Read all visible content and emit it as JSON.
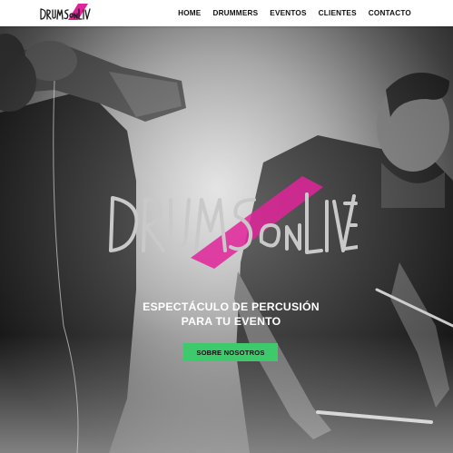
{
  "brand": {
    "name": "DRUMS ON LIVE",
    "logo_text_a": "DRUMS",
    "logo_text_b": "ON",
    "logo_text_c": "LIVE",
    "accent_color": "#e0249a"
  },
  "nav": {
    "items": [
      {
        "label": "HOME"
      },
      {
        "label": "DRUMMERS"
      },
      {
        "label": "EVENTOS"
      },
      {
        "label": "CLIENTES"
      },
      {
        "label": "CONTACTO"
      }
    ]
  },
  "hero": {
    "headline_line1": "ESPECTÁCULO DE PERCUSIÓN",
    "headline_line2": "PARA TU EVENTO",
    "cta_label": "SOBRE NOSOTROS",
    "cta_color": "#3ec96c"
  }
}
